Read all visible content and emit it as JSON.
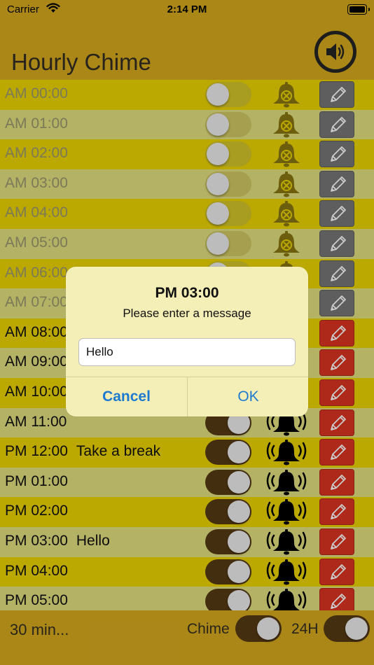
{
  "status_bar": {
    "carrier": "Carrier",
    "time": "2:14 PM"
  },
  "header": {
    "title": "Hourly Chime",
    "speaker_icon": "speaker-volume-icon"
  },
  "rows": [
    {
      "hour": "AM 00:00",
      "message": "",
      "enabled": false
    },
    {
      "hour": "AM 01:00",
      "message": "",
      "enabled": false
    },
    {
      "hour": "AM 02:00",
      "message": "",
      "enabled": false
    },
    {
      "hour": "AM 03:00",
      "message": "",
      "enabled": false
    },
    {
      "hour": "AM 04:00",
      "message": "",
      "enabled": false
    },
    {
      "hour": "AM 05:00",
      "message": "",
      "enabled": false
    },
    {
      "hour": "AM 06:00",
      "message": "",
      "enabled": false
    },
    {
      "hour": "AM 07:00",
      "message": "",
      "enabled": false
    },
    {
      "hour": "AM 08:00",
      "message": "",
      "enabled": true
    },
    {
      "hour": "AM 09:00",
      "message": "",
      "enabled": true
    },
    {
      "hour": "AM 10:00",
      "message": "",
      "enabled": true
    },
    {
      "hour": "AM 11:00",
      "message": "",
      "enabled": true
    },
    {
      "hour": "PM 12:00",
      "message": "Take a break",
      "enabled": true
    },
    {
      "hour": "PM 01:00",
      "message": "",
      "enabled": true
    },
    {
      "hour": "PM 02:00",
      "message": "",
      "enabled": true
    },
    {
      "hour": "PM 03:00",
      "message": "Hello",
      "enabled": true
    },
    {
      "hour": "PM 04:00",
      "message": "",
      "enabled": true
    },
    {
      "hour": "PM 05:00",
      "message": "",
      "enabled": true
    }
  ],
  "footer": {
    "interval_label": "30 min...",
    "chime_label": "Chime",
    "chime_on": true,
    "h24_label": "24H",
    "h24_on": true
  },
  "dialog": {
    "title": "PM 03:00",
    "message": "Please enter a message",
    "input_value": "Hello",
    "cancel_label": "Cancel",
    "ok_label": "OK"
  },
  "colors": {
    "background": "#c29a1b",
    "row_even": "#d5c000",
    "row_odd": "#cccb74",
    "toggle_on": "#4e3513",
    "edit_enabled": "#c72f1e",
    "edit_disabled": "#6c6c6c",
    "dialog_button": "#1e7ad1"
  }
}
